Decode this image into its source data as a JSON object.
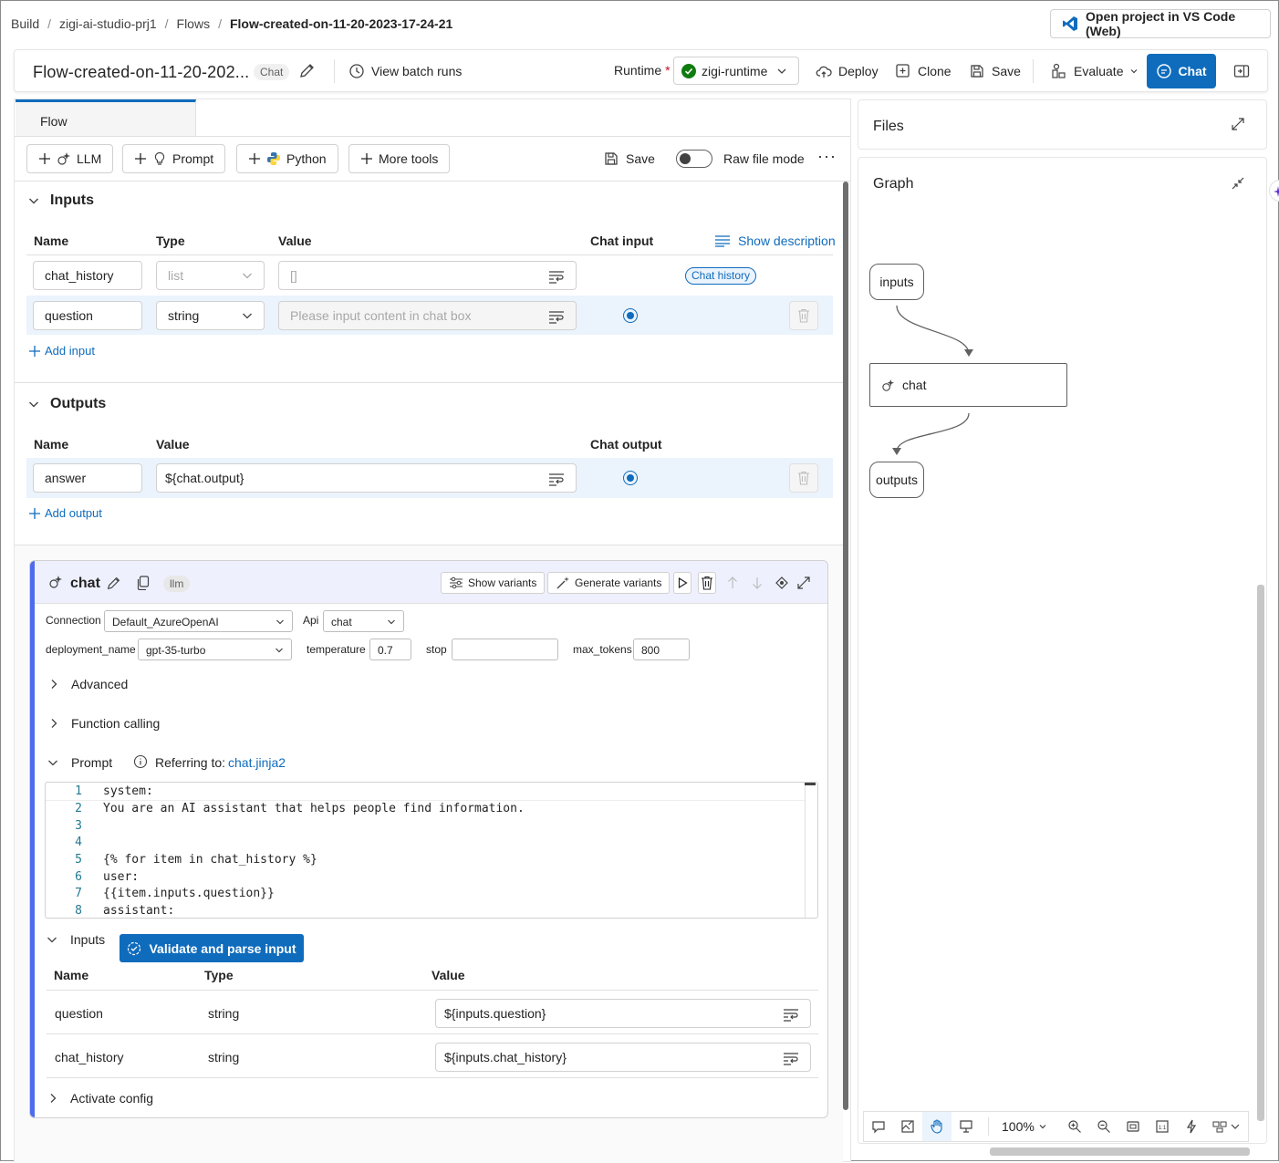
{
  "breadcrumb": {
    "items": [
      "Build",
      "zigi-ai-studio-prj1",
      "Flows",
      "Flow-created-on-11-20-2023-17-24-21"
    ]
  },
  "header": {
    "vscode_button": "Open project in VS Code (Web)",
    "flow_title": "Flow-created-on-11-20-202...",
    "flow_type_badge": "Chat",
    "view_batch_runs": "View batch runs",
    "runtime_label": "Runtime",
    "runtime_required": "*",
    "runtime_value": "zigi-runtime",
    "deploy": "Deploy",
    "clone": "Clone",
    "save": "Save",
    "evaluate": "Evaluate",
    "chat": "Chat",
    "accent_color": "#0f6cbd"
  },
  "flow_tab": {
    "tab_label": "Flow",
    "tools": [
      "LLM",
      "Prompt",
      "Python",
      "More tools"
    ],
    "save": "Save",
    "raw_file_mode": "Raw file mode",
    "raw_file_mode_on": false
  },
  "inputs_section": {
    "title": "Inputs",
    "columns": {
      "name": "Name",
      "type": "Type",
      "value": "Value",
      "chat_input": "Chat input"
    },
    "show_description": "Show description",
    "rows": [
      {
        "name": "chat_history",
        "type": "list",
        "value": "[]",
        "chat_badge": "Chat history"
      },
      {
        "name": "question",
        "type": "string",
        "value_placeholder": "Please input content in chat box",
        "chat_input_selected": true
      }
    ],
    "add_input": "Add input"
  },
  "outputs_section": {
    "title": "Outputs",
    "columns": {
      "name": "Name",
      "value": "Value",
      "chat_output": "Chat output"
    },
    "rows": [
      {
        "name": "answer",
        "value": "${chat.output}",
        "chat_output_selected": true
      }
    ],
    "add_output": "Add output"
  },
  "chat_node": {
    "name": "chat",
    "type_badge": "llm",
    "show_variants": "Show variants",
    "generate_variants": "Generate variants",
    "connection_label": "Connection",
    "connection_value": "Default_AzureOpenAI",
    "api_label": "Api",
    "api_value": "chat",
    "deployment_label": "deployment_name",
    "deployment_value": "gpt-35-turbo",
    "temperature_label": "temperature",
    "temperature_value": "0.7",
    "stop_label": "stop",
    "stop_value": "",
    "max_tokens_label": "max_tokens",
    "max_tokens_value": "800",
    "advanced": "Advanced",
    "function_calling": "Function calling",
    "prompt": "Prompt",
    "referring_to": "Referring to:",
    "prompt_file": "chat.jinja2",
    "code_lines": [
      {
        "n": "1",
        "text": "system:"
      },
      {
        "n": "2",
        "text": "You are an AI assistant that helps people find information."
      },
      {
        "n": "3",
        "text": ""
      },
      {
        "n": "4",
        "text": ""
      },
      {
        "n": "5",
        "text": "{% for item in chat_history %}"
      },
      {
        "n": "6",
        "text": "user:"
      },
      {
        "n": "7",
        "text": "{{item.inputs.question}}"
      },
      {
        "n": "8",
        "text": "assistant:"
      }
    ],
    "inputs_label": "Inputs",
    "validate_button": "Validate and parse input",
    "inputs_columns": {
      "name": "Name",
      "type": "Type",
      "value": "Value"
    },
    "inputs_rows": [
      {
        "name": "question",
        "type": "string",
        "value": "${inputs.question}"
      },
      {
        "name": "chat_history",
        "type": "string",
        "value": "${inputs.chat_history}"
      }
    ],
    "activate_config": "Activate config"
  },
  "right_panel": {
    "files_title": "Files",
    "graph_title": "Graph",
    "graph_nodes": {
      "inputs": "inputs",
      "chat": "chat",
      "outputs": "outputs"
    },
    "zoom": "100%"
  }
}
